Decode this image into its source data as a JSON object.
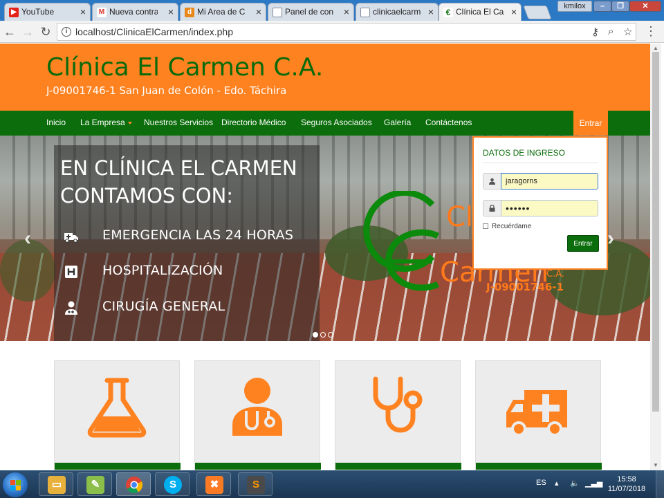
{
  "browser": {
    "tabs": [
      {
        "label": "YouTube",
        "icon": "youtube-icon",
        "color": "#e62117",
        "glyph": "▶"
      },
      {
        "label": "Nueva contraseña",
        "icon": "gmail-icon",
        "color": "#d93025",
        "glyph": "M"
      },
      {
        "label": "Mi Area de Cliente",
        "icon": "hosting-icon",
        "color": "#e8871a",
        "glyph": "d"
      },
      {
        "label": "Panel de control",
        "icon": "page-icon",
        "color": "#7f8c99",
        "glyph": ""
      },
      {
        "label": "clinicaelcarmen",
        "icon": "page-icon",
        "color": "#7f8c99",
        "glyph": ""
      },
      {
        "label": "Clínica El Carmen",
        "icon": "clinic-icon",
        "color": "#0b6d0b",
        "glyph": "C"
      }
    ],
    "profile": "kmilox",
    "url": "localhost/ClinicaElCarmen/index.php"
  },
  "site": {
    "title": "Clínica El Carmen C.A.",
    "subtitle": "J-09001746-1 San Juan de Colón - Edo. Táchira"
  },
  "nav": {
    "items": [
      "Inicio",
      "La Empresa",
      "Nuestros Servicios",
      "Directorio Médico",
      "Seguros Asociados",
      "Galería",
      "Contáctenos"
    ],
    "login": "Entrar"
  },
  "carousel": {
    "heading": "EN CLÍNICA EL CARMEN CONTAMOS CON:",
    "features": [
      "EMERGENCIA LAS 24 HORAS",
      "HOSPITALIZACIÓN",
      "CIRUGÍA GENERAL"
    ],
    "logo_line1": "Clínica",
    "logo_line2": "Carmen",
    "logo_ca": "C.A.",
    "logo_rif": "J-09001746-1"
  },
  "login_panel": {
    "title": "DATOS DE INGRESO",
    "username": "jaragorns",
    "password": "••••••",
    "remember": "Recuérdame",
    "submit": "Entrar"
  },
  "services": [
    {
      "icon": "flask-icon"
    },
    {
      "icon": "doctor-icon"
    },
    {
      "icon": "stethoscope-icon"
    },
    {
      "icon": "ambulance-icon"
    }
  ],
  "taskbar": {
    "lang": "ES",
    "time": "15:58",
    "date": "11/07/2018"
  },
  "colors": {
    "orange": "#ff8221",
    "green": "#0b6d0b"
  }
}
